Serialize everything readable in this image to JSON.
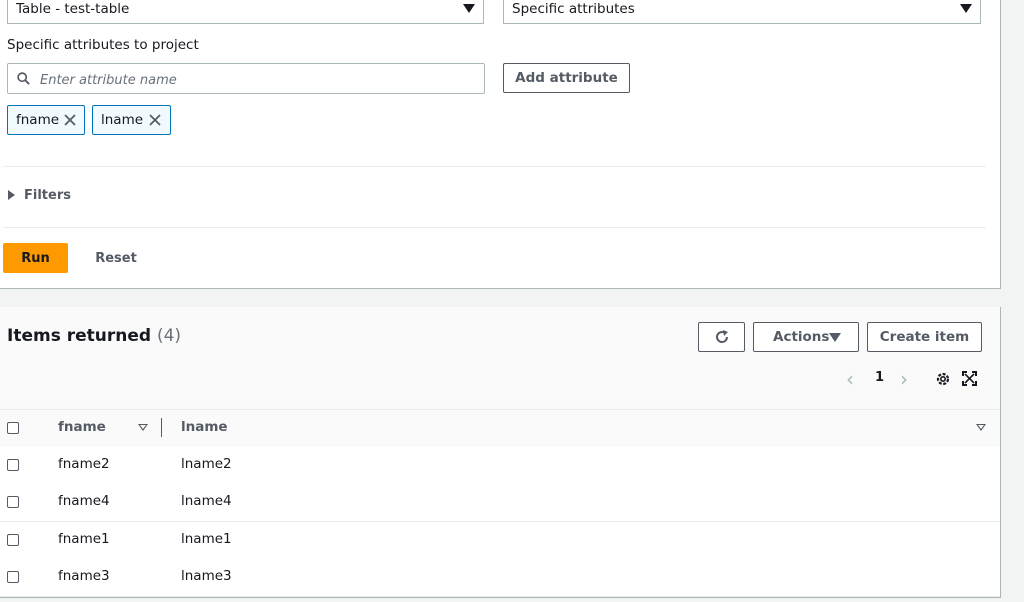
{
  "query": {
    "table_select": "Table - test-table",
    "projection_select": "Specific attributes",
    "projection_label": "Specific attributes to project",
    "attribute_placeholder": "Enter attribute name",
    "add_attribute_label": "Add attribute",
    "tokens": [
      "fname",
      "lname"
    ],
    "filters_label": "Filters",
    "run_label": "Run",
    "reset_label": "Reset"
  },
  "results": {
    "title": "Items returned",
    "count": "(4)",
    "actions_label": "Actions",
    "create_label": "Create item",
    "page": "1",
    "columns": [
      "fname",
      "lname"
    ],
    "rows": [
      [
        "fname2",
        "lname2"
      ],
      [
        "fname4",
        "lname4"
      ],
      [
        "fname1",
        "lname1"
      ],
      [
        "fname3",
        "lname3"
      ]
    ]
  },
  "icons": {
    "search": "search-icon",
    "remove_token": "close-icon",
    "refresh": "refresh-icon",
    "settings": "gear-icon",
    "fullscreen": "fullscreen-icon"
  },
  "colors": {
    "primary": "#ff9900",
    "token_border": "#0073bb",
    "token_bg": "#f1faff"
  }
}
